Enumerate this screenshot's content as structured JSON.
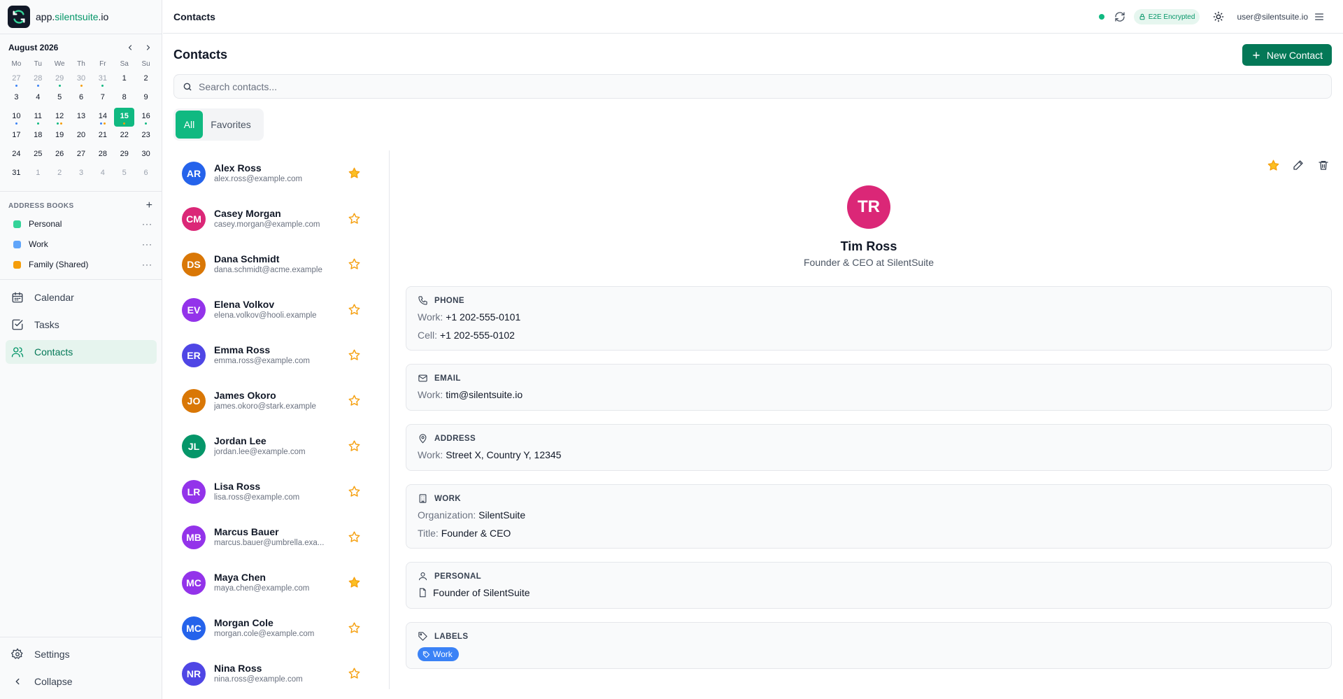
{
  "app": {
    "domain_prefix": "app.",
    "domain_accent": "silentsuite",
    "domain_suffix": ".io"
  },
  "topbar": {
    "title": "Contacts",
    "e2e_label": "E2E Encrypted",
    "user_email": "user@silentsuite.io"
  },
  "calendar": {
    "month_label": "August 2026",
    "weekdays": [
      "Mo",
      "Tu",
      "We",
      "Th",
      "Fr",
      "Sa",
      "Su"
    ],
    "today": "15",
    "days": [
      {
        "d": "27",
        "muted": true,
        "dots": [
          "#3b82f6"
        ]
      },
      {
        "d": "28",
        "muted": true,
        "dots": [
          "#3b82f6"
        ]
      },
      {
        "d": "29",
        "muted": true,
        "dots": [
          "#10b981"
        ]
      },
      {
        "d": "30",
        "muted": true,
        "dots": [
          "#f59e0b"
        ]
      },
      {
        "d": "31",
        "muted": true,
        "dots": [
          "#10b981"
        ]
      },
      {
        "d": "1",
        "muted": false,
        "dots": []
      },
      {
        "d": "2",
        "muted": false,
        "dots": []
      },
      {
        "d": "3",
        "muted": false,
        "dots": []
      },
      {
        "d": "4",
        "muted": false,
        "dots": []
      },
      {
        "d": "5",
        "muted": false,
        "dots": []
      },
      {
        "d": "6",
        "muted": false,
        "dots": []
      },
      {
        "d": "7",
        "muted": false,
        "dots": []
      },
      {
        "d": "8",
        "muted": false,
        "dots": []
      },
      {
        "d": "9",
        "muted": false,
        "dots": []
      },
      {
        "d": "10",
        "muted": false,
        "dots": [
          "#3b82f6"
        ]
      },
      {
        "d": "11",
        "muted": false,
        "dots": [
          "#10b981"
        ]
      },
      {
        "d": "12",
        "muted": false,
        "dots": [
          "#10b981",
          "#f59e0b"
        ]
      },
      {
        "d": "13",
        "muted": false,
        "dots": []
      },
      {
        "d": "14",
        "muted": false,
        "dots": [
          "#3b82f6",
          "#f59e0b"
        ]
      },
      {
        "d": "15",
        "muted": false,
        "dots": [
          "#f59e0b"
        ]
      },
      {
        "d": "16",
        "muted": false,
        "dots": [
          "#10b981"
        ]
      },
      {
        "d": "17",
        "muted": false,
        "dots": []
      },
      {
        "d": "18",
        "muted": false,
        "dots": []
      },
      {
        "d": "19",
        "muted": false,
        "dots": []
      },
      {
        "d": "20",
        "muted": false,
        "dots": []
      },
      {
        "d": "21",
        "muted": false,
        "dots": []
      },
      {
        "d": "22",
        "muted": false,
        "dots": []
      },
      {
        "d": "23",
        "muted": false,
        "dots": []
      },
      {
        "d": "24",
        "muted": false,
        "dots": []
      },
      {
        "d": "25",
        "muted": false,
        "dots": []
      },
      {
        "d": "26",
        "muted": false,
        "dots": []
      },
      {
        "d": "27",
        "muted": false,
        "dots": []
      },
      {
        "d": "28",
        "muted": false,
        "dots": []
      },
      {
        "d": "29",
        "muted": false,
        "dots": []
      },
      {
        "d": "30",
        "muted": false,
        "dots": []
      },
      {
        "d": "31",
        "muted": false,
        "dots": []
      },
      {
        "d": "1",
        "muted": true,
        "dots": []
      },
      {
        "d": "2",
        "muted": true,
        "dots": []
      },
      {
        "d": "3",
        "muted": true,
        "dots": []
      },
      {
        "d": "4",
        "muted": true,
        "dots": []
      },
      {
        "d": "5",
        "muted": true,
        "dots": []
      },
      {
        "d": "6",
        "muted": true,
        "dots": []
      }
    ]
  },
  "address_books": {
    "title": "ADDRESS BOOKS",
    "items": [
      {
        "label": "Personal",
        "color": "#34d399"
      },
      {
        "label": "Work",
        "color": "#60a5fa"
      },
      {
        "label": "Family (Shared)",
        "color": "#f59e0b"
      }
    ]
  },
  "nav": {
    "calendar": "Calendar",
    "tasks": "Tasks",
    "contacts": "Contacts",
    "settings": "Settings",
    "collapse": "Collapse"
  },
  "main": {
    "page_title": "Contacts",
    "new_contact_label": "New Contact",
    "search_placeholder": "Search contacts...",
    "filters": {
      "all": "All",
      "favorites": "Favorites"
    }
  },
  "contacts": [
    {
      "initials": "AR",
      "name": "Alex Ross",
      "email": "alex.ross@example.com",
      "color": "#2563eb",
      "favorite": true
    },
    {
      "initials": "CM",
      "name": "Casey Morgan",
      "email": "casey.morgan@example.com",
      "color": "#db2777",
      "favorite": false
    },
    {
      "initials": "DS",
      "name": "Dana Schmidt",
      "email": "dana.schmidt@acme.example",
      "color": "#d97706",
      "favorite": false
    },
    {
      "initials": "EV",
      "name": "Elena Volkov",
      "email": "elena.volkov@hooli.example",
      "color": "#9333ea",
      "favorite": false
    },
    {
      "initials": "ER",
      "name": "Emma Ross",
      "email": "emma.ross@example.com",
      "color": "#4f46e5",
      "favorite": false
    },
    {
      "initials": "JO",
      "name": "James Okoro",
      "email": "james.okoro@stark.example",
      "color": "#d97706",
      "favorite": false
    },
    {
      "initials": "JL",
      "name": "Jordan Lee",
      "email": "jordan.lee@example.com",
      "color": "#059669",
      "favorite": false
    },
    {
      "initials": "LR",
      "name": "Lisa Ross",
      "email": "lisa.ross@example.com",
      "color": "#9333ea",
      "favorite": false
    },
    {
      "initials": "MB",
      "name": "Marcus Bauer",
      "email": "marcus.bauer@umbrella.exa...",
      "color": "#9333ea",
      "favorite": false
    },
    {
      "initials": "MC",
      "name": "Maya Chen",
      "email": "maya.chen@example.com",
      "color": "#9333ea",
      "favorite": true
    },
    {
      "initials": "MC",
      "name": "Morgan Cole",
      "email": "morgan.cole@example.com",
      "color": "#2563eb",
      "favorite": false
    },
    {
      "initials": "NR",
      "name": "Nina Ross",
      "email": "nina.ross@example.com",
      "color": "#4f46e5",
      "favorite": false
    }
  ],
  "detail": {
    "initials": "TR",
    "name": "Tim Ross",
    "subtitle": "Founder & CEO at SilentSuite",
    "phone": {
      "title": "PHONE",
      "work_key": "Work:",
      "work_val": "+1 202-555-0101",
      "cell_key": "Cell:",
      "cell_val": "+1 202-555-0102"
    },
    "email": {
      "title": "EMAIL",
      "work_key": "Work:",
      "work_val": "tim@silentsuite.io"
    },
    "address": {
      "title": "ADDRESS",
      "work_key": "Work:",
      "work_val": "Street X, Country Y, 12345"
    },
    "work": {
      "title": "WORK",
      "org_key": "Organization:",
      "org_val": "SilentSuite",
      "title_key": "Title:",
      "title_val": "Founder & CEO"
    },
    "personal": {
      "title": "PERSONAL",
      "note": "Founder of SilentSuite"
    },
    "labels": {
      "title": "LABELS",
      "items": [
        "Work"
      ]
    }
  }
}
